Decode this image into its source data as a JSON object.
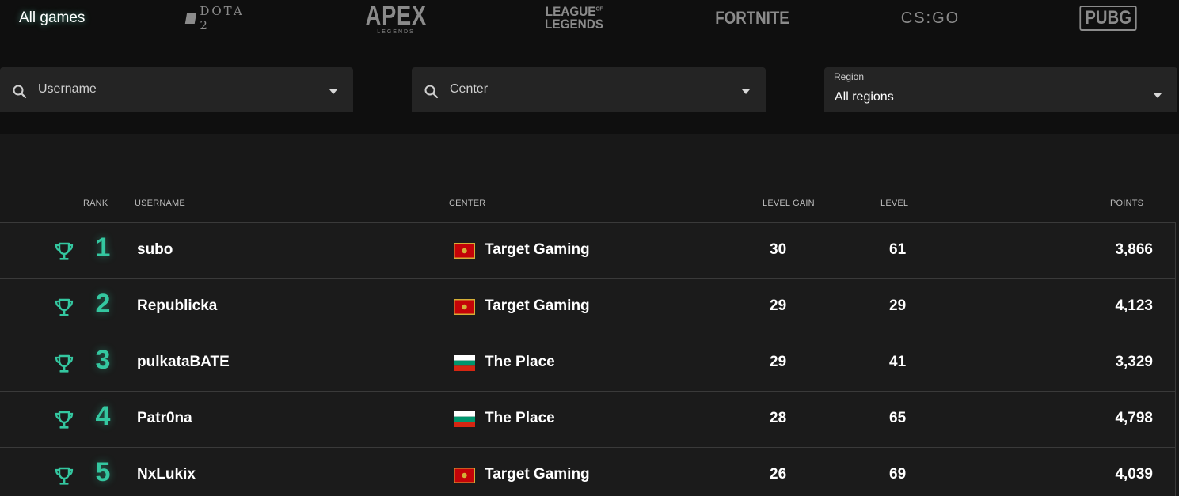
{
  "nav": {
    "all_games": "All games",
    "games": {
      "dota": "DOTA 2",
      "apex_big": "APEX",
      "apex_small": "LEGENDS",
      "lol_1": "LEAGUE",
      "lol_of": "OF",
      "lol_2": "LEGENDS",
      "fortnite": "FORTNITE",
      "csgo": "CS:GO",
      "pubg": "PUBG"
    }
  },
  "filters": {
    "username_placeholder": "Username",
    "center_placeholder": "Center",
    "region_label": "Region",
    "region_value": "All regions"
  },
  "table": {
    "headers": {
      "rank": "RANK",
      "username": "USERNAME",
      "center": "CENTER",
      "level_gain": "LEVEL GAIN",
      "level": "LEVEL",
      "points": "POINTS"
    },
    "rows": [
      {
        "rank": "1",
        "username": "subo",
        "center": "Target Gaming",
        "flag": "montenegro",
        "level_gain": "30",
        "level": "61",
        "points": "3,866"
      },
      {
        "rank": "2",
        "username": "Republicka",
        "center": "Target Gaming",
        "flag": "montenegro",
        "level_gain": "29",
        "level": "29",
        "points": "4,123"
      },
      {
        "rank": "3",
        "username": "pulkataBATE",
        "center": "The Place",
        "flag": "bulgaria",
        "level_gain": "29",
        "level": "41",
        "points": "3,329"
      },
      {
        "rank": "4",
        "username": "Patr0na",
        "center": "The Place",
        "flag": "bulgaria",
        "level_gain": "28",
        "level": "65",
        "points": "4,798"
      },
      {
        "rank": "5",
        "username": "NxLukix",
        "center": "Target Gaming",
        "flag": "montenegro",
        "level_gain": "26",
        "level": "69",
        "points": "4,039"
      }
    ]
  },
  "colors": {
    "accent": "#34c7a0",
    "background": "#0f0f0f",
    "panel": "#181818",
    "field": "#242424"
  },
  "icons": {
    "search": "search-icon",
    "trophy": "trophy-icon",
    "caret": "chevron-down-icon"
  }
}
